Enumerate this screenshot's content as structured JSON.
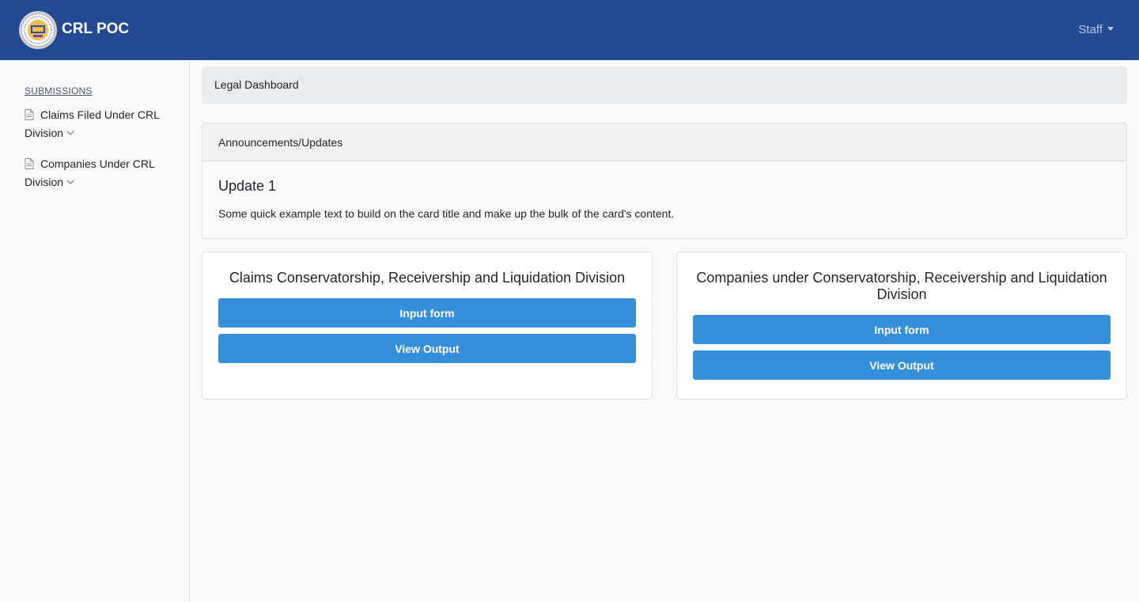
{
  "navbar": {
    "brand": "CRL POC",
    "user_menu": "Staff",
    "bg_color": "#234a93"
  },
  "sidebar": {
    "heading": "SUBMISSIONS",
    "items": [
      {
        "label": "Claims Filed Under CRL Division",
        "icon": "document-icon"
      },
      {
        "label": "Companies Under CRL Division",
        "icon": "document-icon"
      }
    ]
  },
  "breadcrumb": "Legal Dashboard",
  "announcements": {
    "header": "Announcements/Updates",
    "title": "Update 1",
    "text": "Some quick example text to build on the card title and make up the bulk of the card's content."
  },
  "cards": [
    {
      "title": "Claims Conservatorship, Receivership and Liquidation Division",
      "primary_button": "Input form",
      "secondary_button": "View Output"
    },
    {
      "title": "Companies under Conservatorship, Receivership and Liquidation Division",
      "primary_button": "Input form",
      "secondary_button": "View Output"
    }
  ],
  "colors": {
    "button": "#368fdc",
    "navbar": "#234a93"
  }
}
